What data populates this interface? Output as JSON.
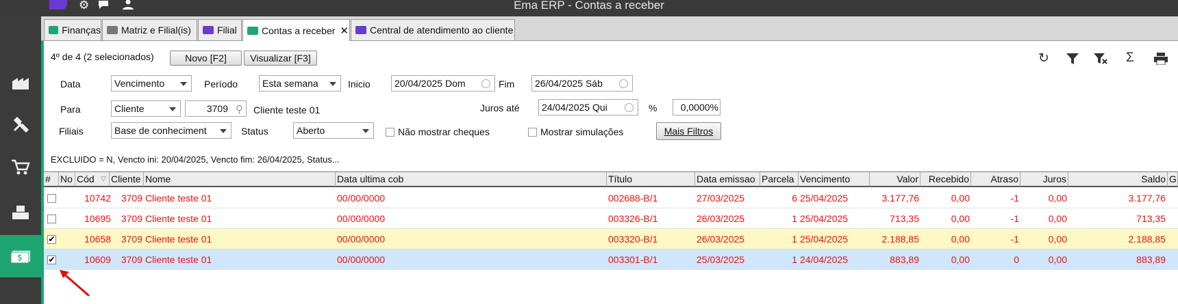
{
  "window": {
    "title": "Ema ERP - Contas a receber"
  },
  "tabs": [
    {
      "label": "Finanças",
      "color": "#1fa572"
    },
    {
      "label": "Matriz e Filial(is)",
      "color": "#777777"
    },
    {
      "label": "Filial",
      "color": "#6a3bd1"
    },
    {
      "label": "Contas a receber",
      "color": "#1fa572",
      "close": "✕"
    },
    {
      "label": "Central de atendimento ao cliente",
      "color": "#6a3bd1"
    }
  ],
  "toolbar": {
    "selection_status": "4º de 4 (2 selecionados)",
    "new_label": "Novo [F2]",
    "view_label": "Visualizar [F3]"
  },
  "filters": {
    "data_label": "Data",
    "data_value": "Vencimento",
    "periodo_label": "Período",
    "periodo_value": "Esta semana",
    "inicio_label": "Inicio",
    "inicio_value": "20/04/2025 Dom",
    "fim_label": "Fim",
    "fim_value": "26/04/2025 Sáb",
    "para_label": "Para",
    "para_value": "Cliente",
    "cliente_code": "3709",
    "cliente_name": "Cliente teste 01",
    "juros_label": "Juros até",
    "juros_value": "24/04/2025 Qui",
    "percent_label": "%",
    "percent_value": "0,0000%",
    "filiais_label": "Filiais",
    "filiais_value": "Base de conheciment",
    "status_label": "Status",
    "status_value": "Aberto",
    "no_cheques_label": "Não mostrar cheques",
    "simulacoes_label": "Mostrar simulações",
    "mais_filtros_label": "Mais Filtros"
  },
  "filter_summary": "EXCLUIDO = N, Vencto ini: 20/04/2025, Vencto fim: 26/04/2025, Status...",
  "columns": {
    "hash": "#",
    "no": "No",
    "cod": "Cód",
    "cliente": "Cliente",
    "nome": "Nome",
    "data_ultima": "Data ultima cob",
    "titulo": "Título",
    "data_emissao": "Data emissao",
    "parcela": "Parcela",
    "vencimento": "Vencimento",
    "valor": "Valor",
    "recebido": "Recebido",
    "atraso": "Atraso",
    "juros": "Juros",
    "saldo": "Saldo",
    "extra": "G"
  },
  "rows": [
    {
      "checked": false,
      "cod": "10742",
      "cliente": "3709",
      "nome": "Cliente teste 01",
      "data_ultima": "00/00/0000",
      "titulo": "002688-B/1",
      "data_emissao": "27/03/2025",
      "parcela": "6",
      "vencimento": "25/04/2025",
      "valor": "3.177,76",
      "recebido": "0,00",
      "atraso": "-1",
      "juros": "0,00",
      "saldo": "3.177,76",
      "bg": "#ffffff"
    },
    {
      "checked": false,
      "cod": "10695",
      "cliente": "3709",
      "nome": "Cliente teste 01",
      "data_ultima": "00/00/0000",
      "titulo": "003326-B/1",
      "data_emissao": "26/03/2025",
      "parcela": "1",
      "vencimento": "25/04/2025",
      "valor": "713,35",
      "recebido": "0,00",
      "atraso": "-1",
      "juros": "0,00",
      "saldo": "713,35",
      "bg": "#ffffff"
    },
    {
      "checked": true,
      "cod": "10658",
      "cliente": "3709",
      "nome": "Cliente teste 01",
      "data_ultima": "00/00/0000",
      "titulo": "003320-B/1",
      "data_emissao": "26/03/2025",
      "parcela": "1",
      "vencimento": "25/04/2025",
      "valor": "2.188,85",
      "recebido": "0,00",
      "atraso": "-1",
      "juros": "0,00",
      "saldo": "2.188,85",
      "bg": "#fdf8c4"
    },
    {
      "checked": true,
      "cod": "10609",
      "cliente": "3709",
      "nome": "Cliente teste 01",
      "data_ultima": "00/00/0000",
      "titulo": "003301-B/1",
      "data_emissao": "25/03/2025",
      "parcela": "1",
      "vencimento": "24/04/2025",
      "valor": "883,89",
      "recebido": "0,00",
      "atraso": "0",
      "juros": "0,00",
      "saldo": "883,89",
      "bg": "#cfe6fb"
    }
  ],
  "icons": {
    "gear": "⚙",
    "refresh": "↻",
    "filter": "▼",
    "sum": "Σ",
    "print": "⎙"
  },
  "colors": {
    "accent": "#1fa572",
    "row_text": "#ee1111",
    "brand_purple": "#6a3bd1"
  }
}
